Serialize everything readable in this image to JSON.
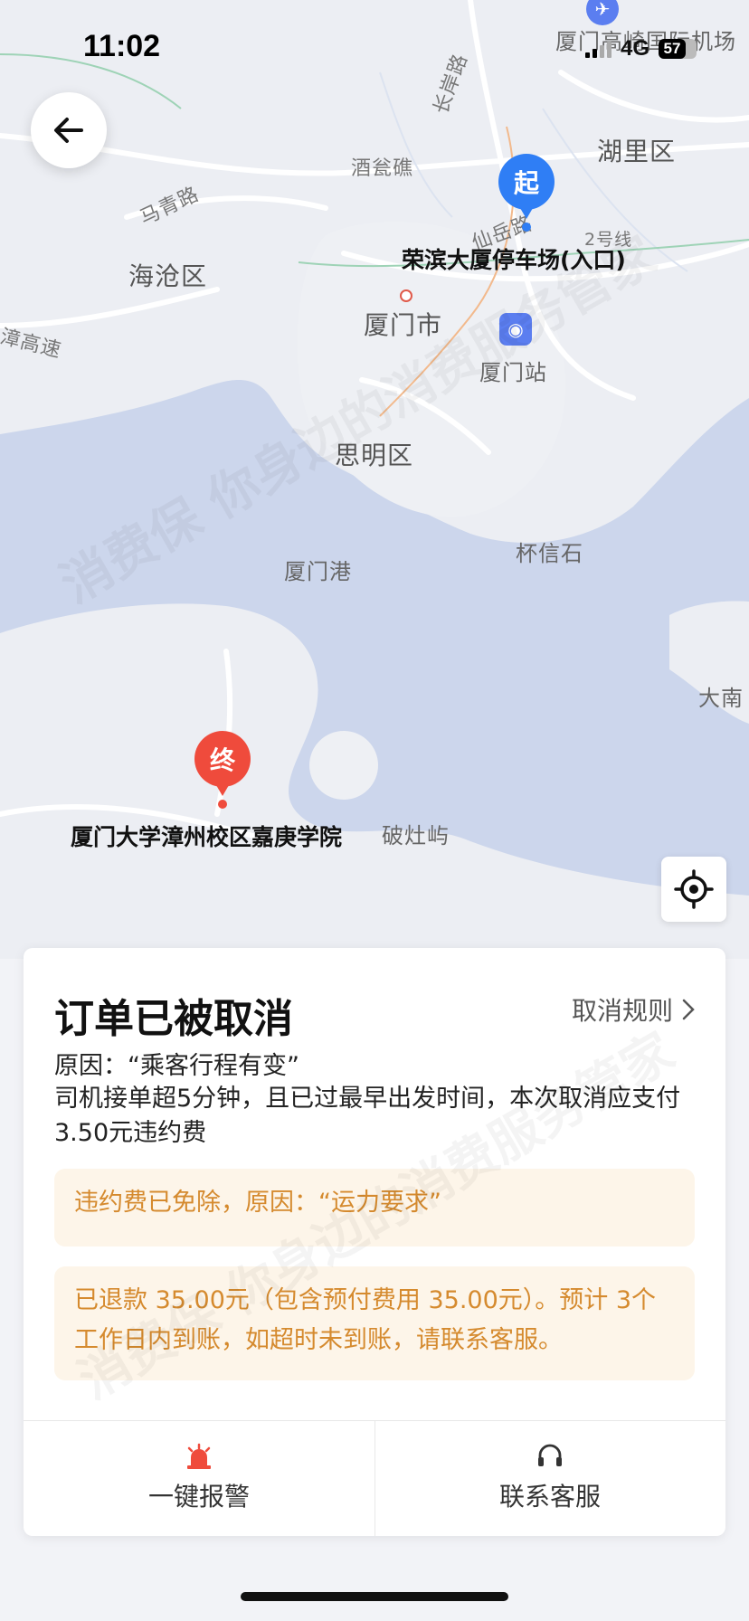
{
  "status_bar": {
    "time": "11:02",
    "network": "4G",
    "battery": "57"
  },
  "map": {
    "labels": {
      "xiamen_airport": "厦门高崎国际机场",
      "huli": "湖里区",
      "changan_road": "长岸路",
      "jiugongjiao": "酒瓮礁",
      "maqing_road": "马青路",
      "haicang": "海沧区",
      "xianyue_road": "仙岳路",
      "metro_line2": "2号线",
      "xiamen_city": "厦门市",
      "xiamen_station": "厦门站",
      "highway": "漳高速",
      "siming": "思明区",
      "beixinshi": "杯信石",
      "xiamen_port": "厦门港",
      "danan": "大南",
      "pozaoyu": "破灶屿"
    },
    "start_pin": {
      "text": "起",
      "label": "荣滨大厦停车场(入口)",
      "color": "#2f7ef5"
    },
    "end_pin": {
      "text": "终",
      "label": "厦门大学漳州校区嘉庚学院",
      "color": "#ef4b3c"
    }
  },
  "card": {
    "title": "订单已被取消",
    "rule_link": "取消规则",
    "reason": "原因：“乘客行程有变”",
    "description": "司机接单超5分钟，且已过最早出发时间，本次取消应支付3.50元违约费",
    "fee_waived_notice": "违约费已免除，原因：“运力要求”",
    "refund_notice": "已退款 35.00元（包含预付费用 35.00元）。预计 3个工作日内到账，如超时未到账，请联系客服。",
    "notice_color": "#d58a2e",
    "actions": {
      "alarm_label": "一键报警",
      "service_label": "联系客服"
    }
  },
  "watermark_text": "消费保 你身边的消费服务管家"
}
